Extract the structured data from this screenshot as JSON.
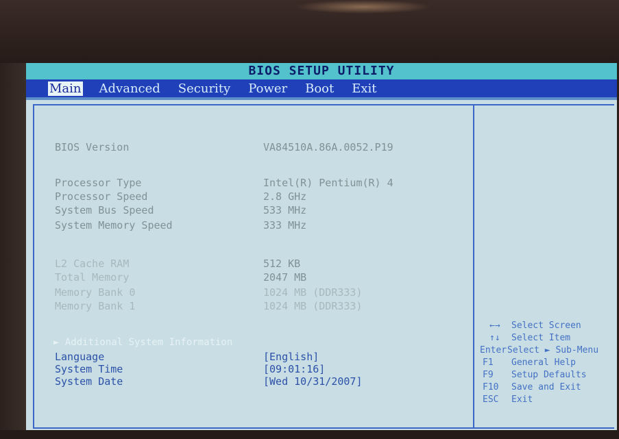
{
  "title": "BIOS SETUP UTILITY",
  "menu": [
    {
      "label": "Main",
      "active": true
    },
    {
      "label": "Advanced"
    },
    {
      "label": "Security"
    },
    {
      "label": "Power"
    },
    {
      "label": "Boot"
    },
    {
      "label": "Exit"
    }
  ],
  "info": {
    "bios_version": {
      "label": "BIOS Version",
      "value": "VA84510A.86A.0052.P19"
    },
    "processor_type": {
      "label": "Processor Type",
      "value": "Intel(R) Pentium(R) 4"
    },
    "processor_speed": {
      "label": "Processor Speed",
      "value": "2.8 GHz"
    },
    "system_bus_speed": {
      "label": "System Bus Speed",
      "value": "533 MHz"
    },
    "system_memory_speed": {
      "label": "System Memory Speed",
      "value": "333 MHz"
    },
    "l2_cache": {
      "label": "L2 Cache RAM",
      "value": "512 KB"
    },
    "total_memory": {
      "label": "Total Memory",
      "value": "2047 MB"
    },
    "memory_bank_0": {
      "label": "Memory Bank 0",
      "value": "1024 MB (DDR333)"
    },
    "memory_bank_1": {
      "label": "Memory Bank 1",
      "value": "1024 MB (DDR333)"
    }
  },
  "additional": {
    "heading": "► Additional System Information",
    "language": {
      "label": "Language",
      "value": "[English]"
    },
    "system_time": {
      "label": "System Time",
      "value": "[09:01:16]"
    },
    "system_date": {
      "label": "System Date",
      "value": "[Wed 10/31/2007]"
    }
  },
  "help": [
    {
      "key": "←→",
      "desc": "Select Screen"
    },
    {
      "key": "↑↓",
      "desc": "Select Item"
    },
    {
      "key": "Enter",
      "desc": "Select ► Sub-Menu"
    },
    {
      "key": "F1",
      "desc": "General Help"
    },
    {
      "key": "F9",
      "desc": "Setup Defaults"
    },
    {
      "key": "F10",
      "desc": "Save and Exit"
    },
    {
      "key": "ESC",
      "desc": "Exit"
    }
  ]
}
